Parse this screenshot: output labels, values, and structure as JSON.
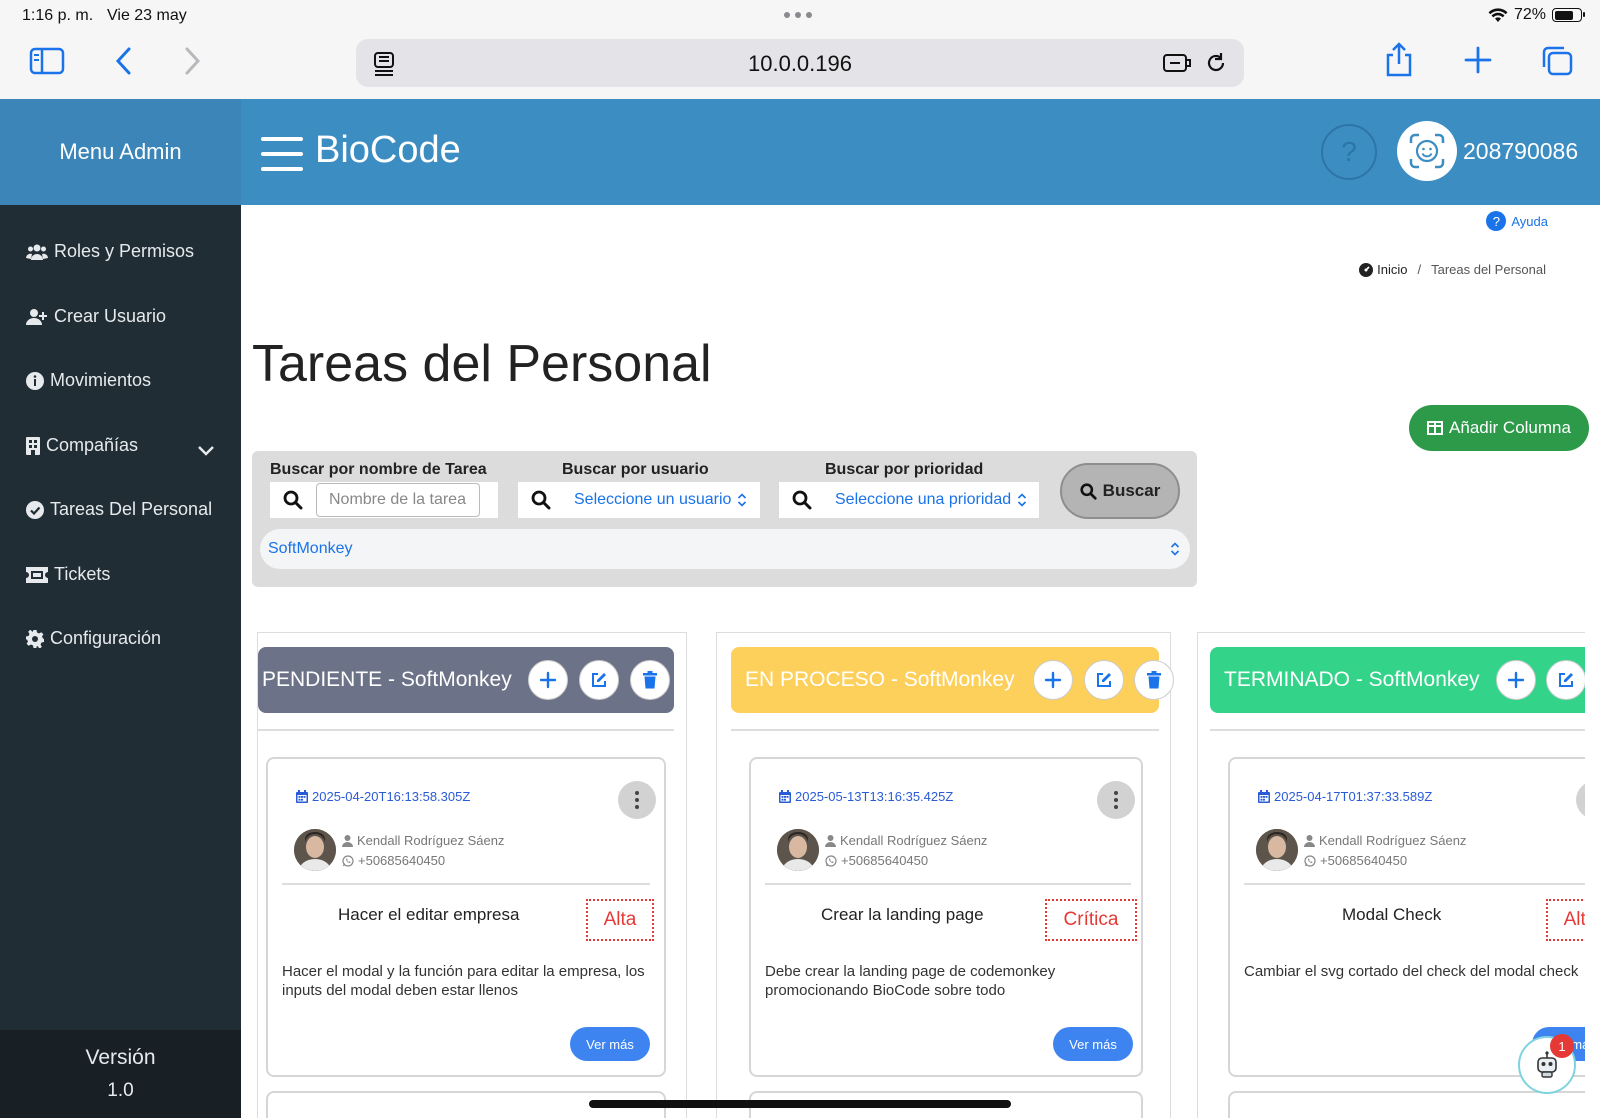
{
  "status": {
    "time": "1:16 p. m.",
    "date": "Vie 23 may",
    "battery": "72%"
  },
  "browser": {
    "url": "10.0.0.196"
  },
  "sidebar": {
    "header": "Menu Admin",
    "items": [
      {
        "label": "Roles y Permisos",
        "icon": "users-icon"
      },
      {
        "label": "Crear Usuario",
        "icon": "user-plus-icon"
      },
      {
        "label": "Movimientos",
        "icon": "info-icon"
      },
      {
        "label": "Compañías",
        "icon": "building-icon"
      },
      {
        "label": "Tareas Del Personal",
        "icon": "check-circle-icon"
      },
      {
        "label": "Tickets",
        "icon": "ticket-icon"
      },
      {
        "label": "Configuración",
        "icon": "gear-icon"
      }
    ],
    "version_label": "Versión",
    "version_number": "1.0"
  },
  "header": {
    "brand": "BioCode",
    "help_symbol": "?",
    "user_id": "208790086"
  },
  "help_link": "Ayuda",
  "breadcrumb": {
    "home": "Inicio",
    "separator": "/",
    "current": "Tareas del Personal"
  },
  "page_title": "Tareas del Personal",
  "add_column_label": "Añadir Columna",
  "search": {
    "task_label": "Buscar por nombre de Tarea",
    "task_placeholder": "Nombre de la tarea",
    "user_label": "Buscar por usuario",
    "user_value": "Seleccione un usuario",
    "priority_label": "Buscar por prioridad",
    "priority_value": "Seleccione una prioridad",
    "button_label": "Buscar",
    "company_value": "SoftMonkey"
  },
  "columns": [
    {
      "title": "PENDIENTE - SoftMonkey",
      "color": "#6c7287",
      "task": {
        "date": "2025-04-20T16:13:58.305Z",
        "user": "Kendall Rodríguez Sáenz",
        "phone": "+50685640450",
        "name": "Hacer el editar empresa",
        "priority": "Alta",
        "description": "Hacer el modal y la función para editar la empresa, los inputs del modal deben estar llenos",
        "more_label": "Ver más"
      }
    },
    {
      "title": "EN PROCESO - SoftMonkey",
      "color": "#fdd05c",
      "task": {
        "date": "2025-05-13T13:16:35.425Z",
        "user": "Kendall Rodríguez Sáenz",
        "phone": "+50685640450",
        "name": "Crear la landing page",
        "priority": "Crítica",
        "description": "Debe crear la landing page de codemonkey promocionando BioCode sobre todo",
        "more_label": "Ver más"
      }
    },
    {
      "title": "TERMINADO - SoftMonkey",
      "color": "#33d38a",
      "task": {
        "date": "2025-04-17T01:37:33.589Z",
        "user": "Kendall Rodríguez Sáenz",
        "phone": "+50685640450",
        "name": "Modal Check",
        "priority": "Alta",
        "description": "Cambiar el svg cortado del check del modal check",
        "more_label": "Ver más"
      }
    }
  ],
  "chat": {
    "badge_count": "1"
  }
}
